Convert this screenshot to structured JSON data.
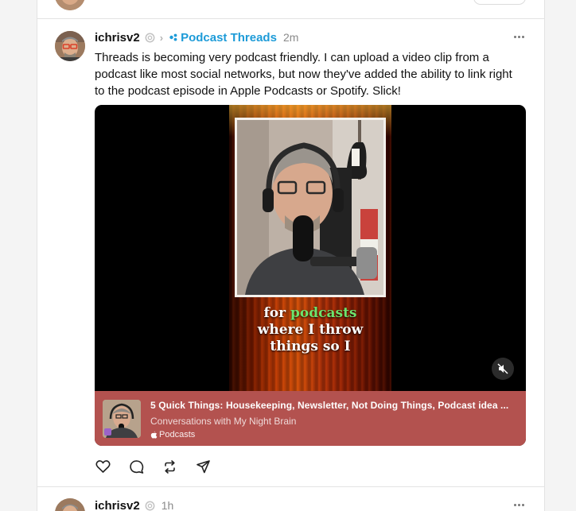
{
  "post": {
    "username": "ichrisv2",
    "topic": "Podcast Threads",
    "timestamp": "2m",
    "text": "Threads is becoming very podcast friendly. I can upload a video clip from a podcast like most social networks, but now they've added the ability to link right to the podcast episode in Apple Podcasts or Spotify. Slick!",
    "video": {
      "caption_line1_pre": "for ",
      "caption_line1_highlight": "podcasts",
      "caption_line2": "where I throw",
      "caption_line3": "things so I",
      "mute_icon": "muted-speaker-icon"
    },
    "podcast_link": {
      "title": "5 Quick Things: Housekeeping, Newsletter, Not Doing Things, Podcast idea ...",
      "show": "Conversations with My Night Brain",
      "source": "Podcasts",
      "source_icon": "apple-icon"
    },
    "actions": [
      "heart-icon",
      "comment-icon",
      "repost-icon",
      "share-icon"
    ]
  },
  "next_post": {
    "username": "ichrisv2",
    "timestamp": "1h"
  },
  "colors": {
    "topic": "#1d9bd8",
    "podcast_bar": "#b3524f",
    "caption_highlight": "#6de36d"
  }
}
